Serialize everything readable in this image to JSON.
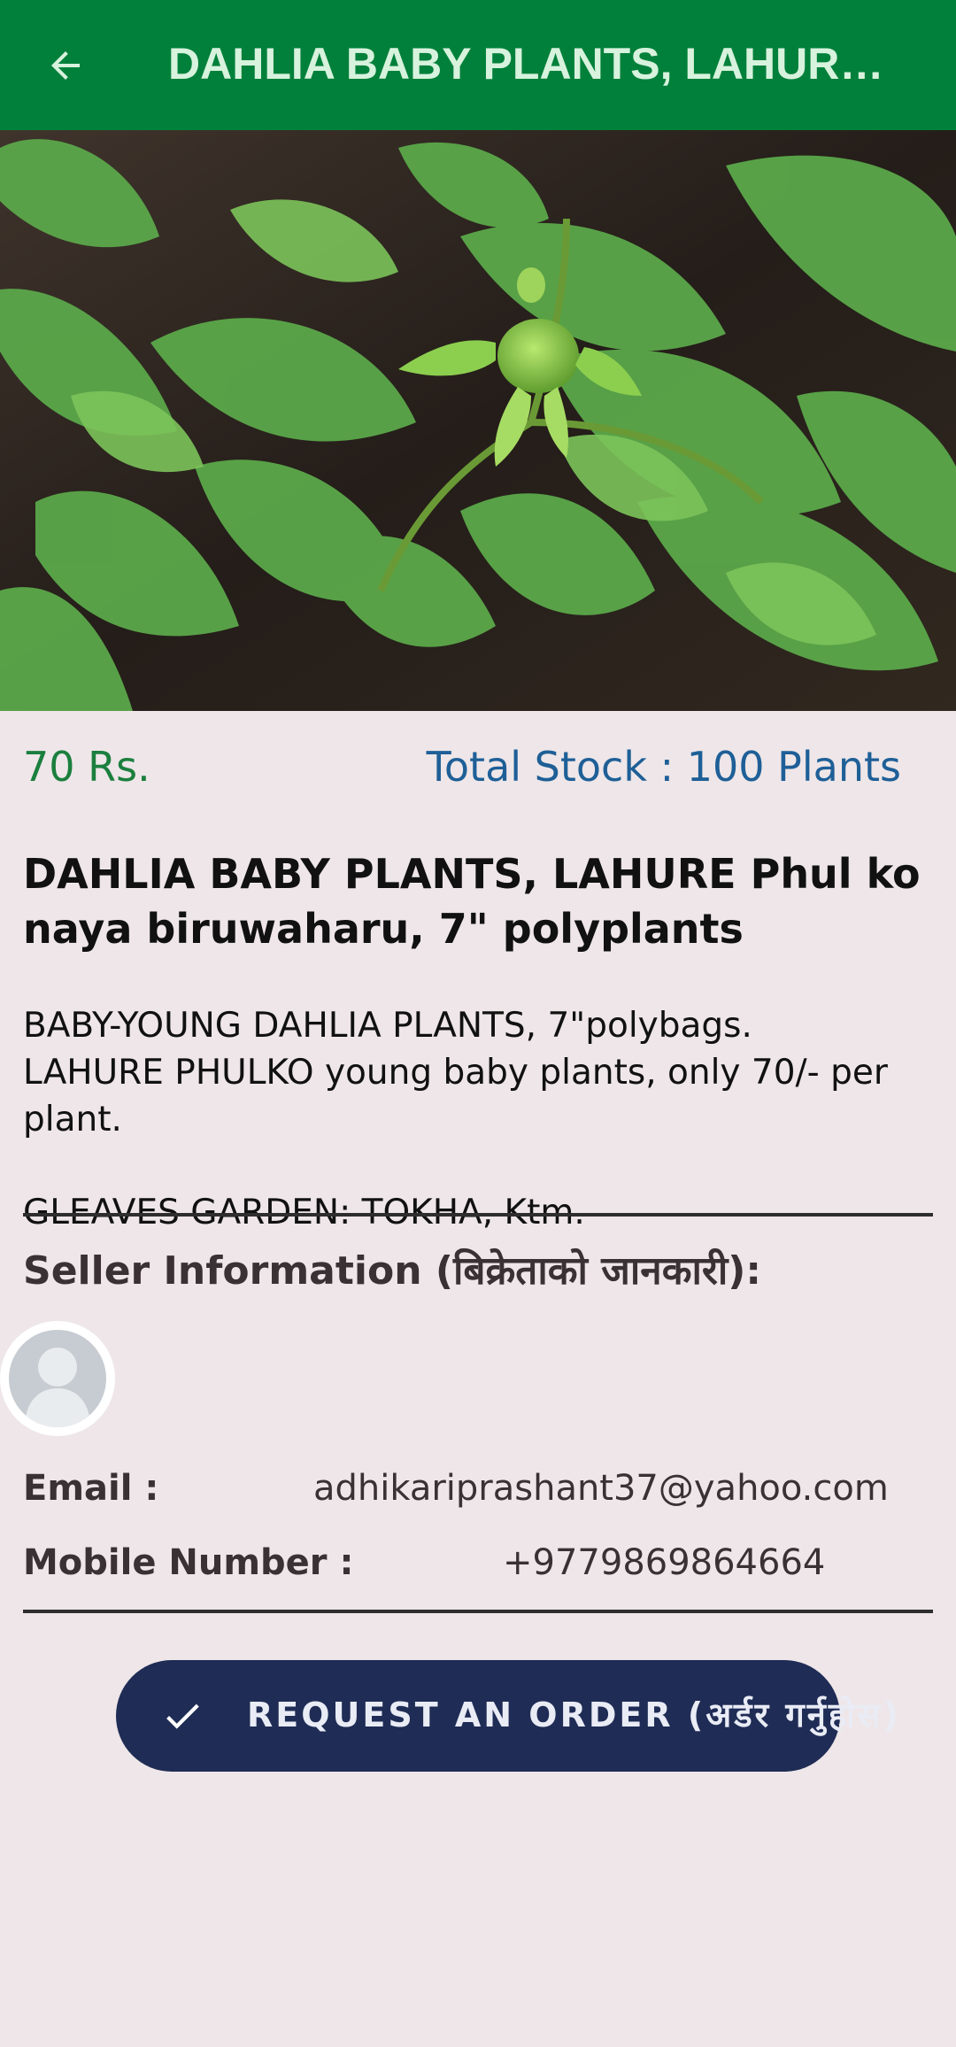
{
  "app_bar": {
    "title": "DAHLIA BABY PLANTS, LAHURE...",
    "back_icon": "arrow-back-icon",
    "background_color": "#00803a"
  },
  "product": {
    "image_subject": "young green dahlia plant with flower bud",
    "price": "70 Rs.",
    "stock": "Total Stock : 100 Plants",
    "title": "DAHLIA BABY PLANTS, LAHURE Phul ko naya biruwaharu, 7\" polyplants",
    "description_lines": [
      "BABY-YOUNG DAHLIA PLANTS, 7\"polybags.",
      "LAHURE PHULKO young baby plants, only 70/- per plant.",
      "GLEAVES GARDEN: TOKHA, Ktm."
    ]
  },
  "seller": {
    "heading": "Seller Information (बिक्रेताको जानकारी):",
    "avatar_icon": "default-avatar-icon",
    "email_label": "Email :",
    "email_value": "adhikariprashant37@yahoo.com",
    "mobile_label": "Mobile Number :",
    "mobile_value": "+9779869864664"
  },
  "action": {
    "order_label": "REQUEST AN ORDER (अर्डर गर्नुहोस)",
    "icon": "check-icon",
    "button_color": "#1f2c55"
  },
  "colors": {
    "page_background": "#eee6e8",
    "price_color": "#1b7f3e",
    "stock_color": "#1e5f97"
  }
}
